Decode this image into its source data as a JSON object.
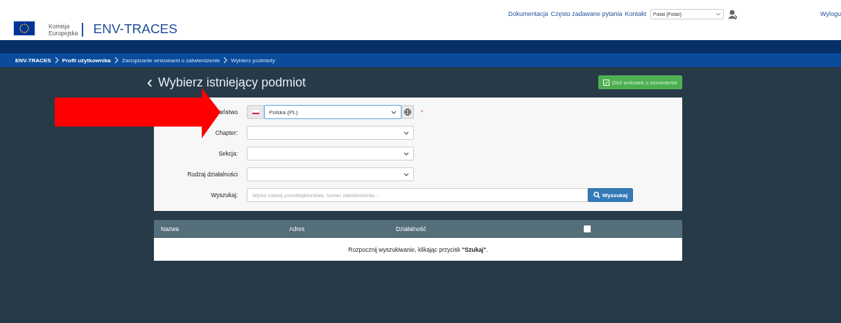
{
  "header": {
    "logo_text": [
      "Komisja",
      "Europejska"
    ],
    "app_title": "ENV-TRACES",
    "links": [
      "Dokumentacja",
      "Często zadawane pytania",
      "Kontakt"
    ],
    "language": "Polski (Polski)",
    "logout": "Wylogu"
  },
  "breadcrumb": [
    {
      "label": "ENV-TRACES",
      "bold": true
    },
    {
      "label": "Profil użytkownika",
      "bold": true
    },
    {
      "label": "Zarządzanie wnioskami o zatwierdzenie",
      "bold": false
    },
    {
      "label": "Wybierz podmioty",
      "bold": false
    }
  ],
  "page": {
    "title": "Wybierz istniejący podmiot",
    "back": "‹",
    "action_button": "Złóż wniosek o zezwolenie"
  },
  "form": [
    {
      "kind": "country",
      "label": "aństwo",
      "value": "Polska (PL)",
      "required_mark": "*"
    },
    {
      "kind": "select",
      "label": "Chapter:"
    },
    {
      "kind": "select",
      "label": "Sekcja:"
    },
    {
      "kind": "select",
      "label": "Rodzaj działalności"
    },
    {
      "kind": "search",
      "label": "Wyszukaj:",
      "placeholder": "Wpisz nazwę przedsiębiorstwa, numer zatwierdzenia...",
      "button": "Wyszukaj"
    }
  ],
  "table": {
    "columns": [
      "Nazwa",
      "Adres",
      "Działalność"
    ],
    "select_all": {
      "checked": false
    },
    "empty_message": "Rozpocznij wyszukiwanie, klikając przycisk **\"Szukaj\"**."
  },
  "annotation": {
    "kind": "arrow"
  }
}
